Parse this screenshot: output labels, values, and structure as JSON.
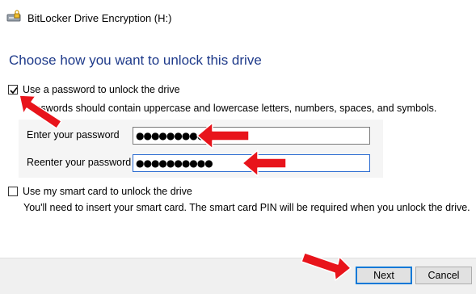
{
  "window": {
    "title": "BitLocker Drive Encryption (H:)",
    "icon": "bitlocker-drive-icon"
  },
  "page": {
    "heading": "Choose how you want to unlock this drive"
  },
  "password_option": {
    "label": "Use a password to unlock the drive",
    "checked": true,
    "hint": "Passwords should contain uppercase and lowercase letters, numbers, spaces, and symbols.",
    "enter_label": "Enter your password",
    "enter_value": "●●●●●●●●●●",
    "reenter_label": "Reenter your password",
    "reenter_value": "●●●●●●●●●●"
  },
  "smartcard_option": {
    "label": "Use my smart card to unlock the drive",
    "checked": false,
    "hint": "You'll need to insert your smart card. The smart card PIN will be required when you unlock the drive."
  },
  "buttons": {
    "next": "Next",
    "cancel": "Cancel"
  },
  "annotations": {
    "arrow_color": "#e8141b"
  }
}
